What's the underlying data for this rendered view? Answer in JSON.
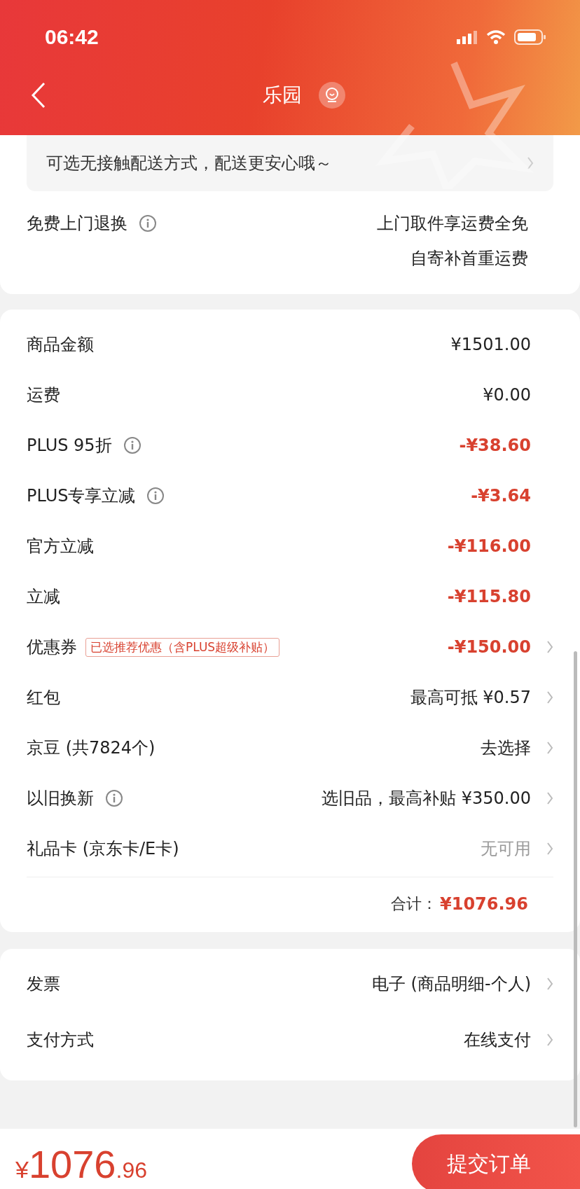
{
  "status_bar": {
    "time": "06:42"
  },
  "header": {
    "title": "乐园"
  },
  "notice": {
    "text": "可选无接触配送方式，配送更安心哦～"
  },
  "return_service": {
    "label": "免费上门退换",
    "lines": [
      "上门取件享运费全免",
      "自寄补首重运费"
    ]
  },
  "charges": [
    {
      "label": "商品金额",
      "info": false,
      "value": "¥1501.00",
      "kind": "normal",
      "chevron": false
    },
    {
      "label": "运费",
      "info": false,
      "value": "¥0.00",
      "kind": "normal",
      "chevron": false
    },
    {
      "label": "PLUS 95折",
      "info": true,
      "value": "-¥38.60",
      "kind": "discount",
      "chevron": false
    },
    {
      "label": "PLUS专享立减",
      "info": true,
      "value": "-¥3.64",
      "kind": "discount",
      "chevron": false
    },
    {
      "label": "官方立减",
      "info": false,
      "value": "-¥116.00",
      "kind": "discount",
      "chevron": false
    },
    {
      "label": "立减",
      "info": false,
      "value": "-¥115.80",
      "kind": "discount",
      "chevron": false
    },
    {
      "label": "优惠券",
      "info": false,
      "tag": "已选推荐优惠（含PLUS超级补贴）",
      "value": "-¥150.00",
      "kind": "discount",
      "chevron": true
    },
    {
      "label": "红包",
      "info": false,
      "value": "最高可抵 ¥0.57",
      "kind": "normal",
      "chevron": true
    },
    {
      "label": "京豆 (共7824个)",
      "info": false,
      "value": "去选择",
      "kind": "normal",
      "chevron": true
    },
    {
      "label": "以旧换新",
      "info": true,
      "value": "选旧品，最高补贴 ¥350.00",
      "kind": "normal",
      "chevron": true
    },
    {
      "label": "礼品卡 (京东卡/E卡)",
      "info": false,
      "value": "无可用",
      "kind": "muted",
      "chevron": true
    }
  ],
  "total": {
    "label": "合计：",
    "value": "¥1076.96"
  },
  "settings": [
    {
      "label": "发票",
      "value": "电子 (商品明细-个人)"
    },
    {
      "label": "支付方式",
      "value": "在线支付"
    }
  ],
  "footer": {
    "currency": "¥",
    "price_integer": "1076",
    "price_decimal": ".96",
    "submit": "提交订单"
  }
}
